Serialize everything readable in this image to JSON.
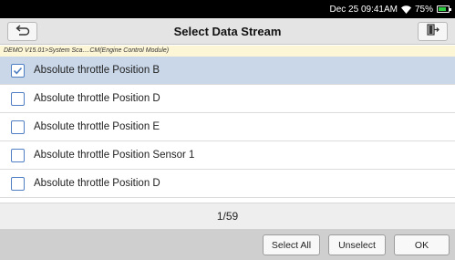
{
  "status_bar": {
    "datetime": "Dec 25 09:41AM",
    "battery_text": "75%",
    "battery_level": 0.75,
    "battery_color": "#2ecc40"
  },
  "header": {
    "title": "Select Data Stream",
    "back_icon": "back-arrow-icon",
    "exit_icon": "exit-icon"
  },
  "breadcrumb": "DEMO V15.01>System Sca....CM(Engine Control Module)",
  "list": {
    "items": [
      {
        "label": "Absolute throttle Position B",
        "checked": true
      },
      {
        "label": "Absolute throttle Position D",
        "checked": false
      },
      {
        "label": "Absolute throttle Position E",
        "checked": false
      },
      {
        "label": "Absolute throttle Position Sensor 1",
        "checked": false
      },
      {
        "label": "Absolute throttle Position D",
        "checked": false
      }
    ]
  },
  "pager": {
    "text": "1/59"
  },
  "footer": {
    "select_all": "Select All",
    "unselect": "Unselect",
    "ok": "OK"
  },
  "colors": {
    "selected_row": "#c9d7e9",
    "checkbox_border": "#4f7fc2",
    "breadcrumb_bg": "#fdf6d6"
  }
}
